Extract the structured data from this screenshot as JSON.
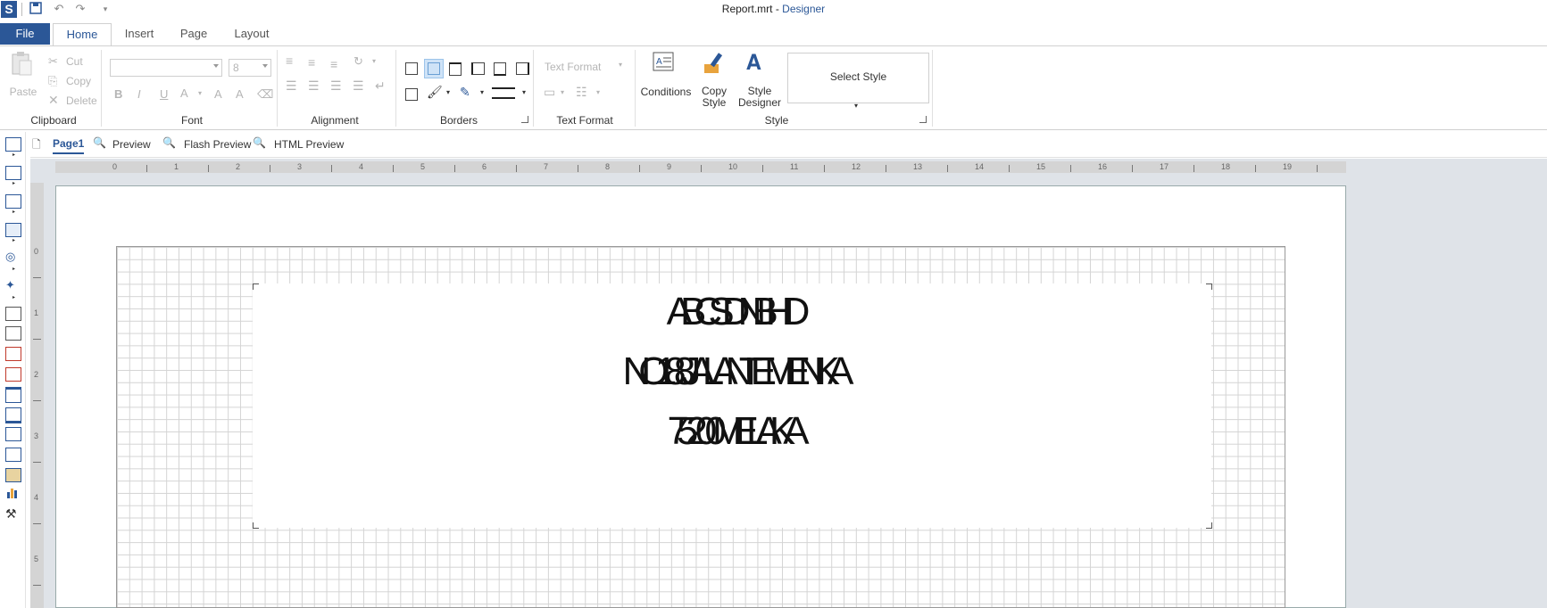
{
  "titlebar": {
    "file_name": "Report.mrt",
    "separator": " - ",
    "app_name": "Designer",
    "logo_letter": "S"
  },
  "tabs": {
    "file": "File",
    "home": "Home",
    "insert": "Insert",
    "page": "Page",
    "layout": "Layout"
  },
  "ribbon": {
    "clipboard": {
      "label": "Clipboard",
      "paste": "Paste",
      "cut": "Cut",
      "copy": "Copy",
      "delete": "Delete"
    },
    "font": {
      "label": "Font",
      "size_value": "8",
      "bold": "B",
      "italic": "I",
      "underline": "U",
      "font_color": "A",
      "grow": "A",
      "shrink": "A"
    },
    "alignment": {
      "label": "Alignment"
    },
    "borders": {
      "label": "Borders"
    },
    "text_format": {
      "label": "Text Format",
      "combo_value": "Text Format"
    },
    "style": {
      "label": "Style",
      "conditions": "Conditions",
      "copy_style_1": "Copy",
      "copy_style_2": "Style",
      "style_designer_1": "Style",
      "style_designer_2": "Designer",
      "select_style": "Select Style"
    }
  },
  "doc_tabs": {
    "page1": "Page1",
    "preview": "Preview",
    "flash_preview": "Flash Preview",
    "html_preview": "HTML Preview"
  },
  "ruler": {
    "h_ticks": [
      "0",
      "1",
      "2",
      "3",
      "4",
      "5",
      "6",
      "7",
      "8",
      "9",
      "10",
      "11",
      "12",
      "13",
      "14",
      "15",
      "16",
      "17",
      "18",
      "19"
    ],
    "v_ticks": [
      "0",
      "1",
      "2",
      "3",
      "4",
      "5"
    ]
  },
  "report": {
    "line1": "ABC SDN BHD",
    "line2": "NO 188 JALAN TEMENKA",
    "line3": "75200 MELAKA"
  },
  "colors": {
    "accent": "#2b5797",
    "canvas_bg": "#dfe3e8",
    "grid_line": "#d4d4d4"
  }
}
